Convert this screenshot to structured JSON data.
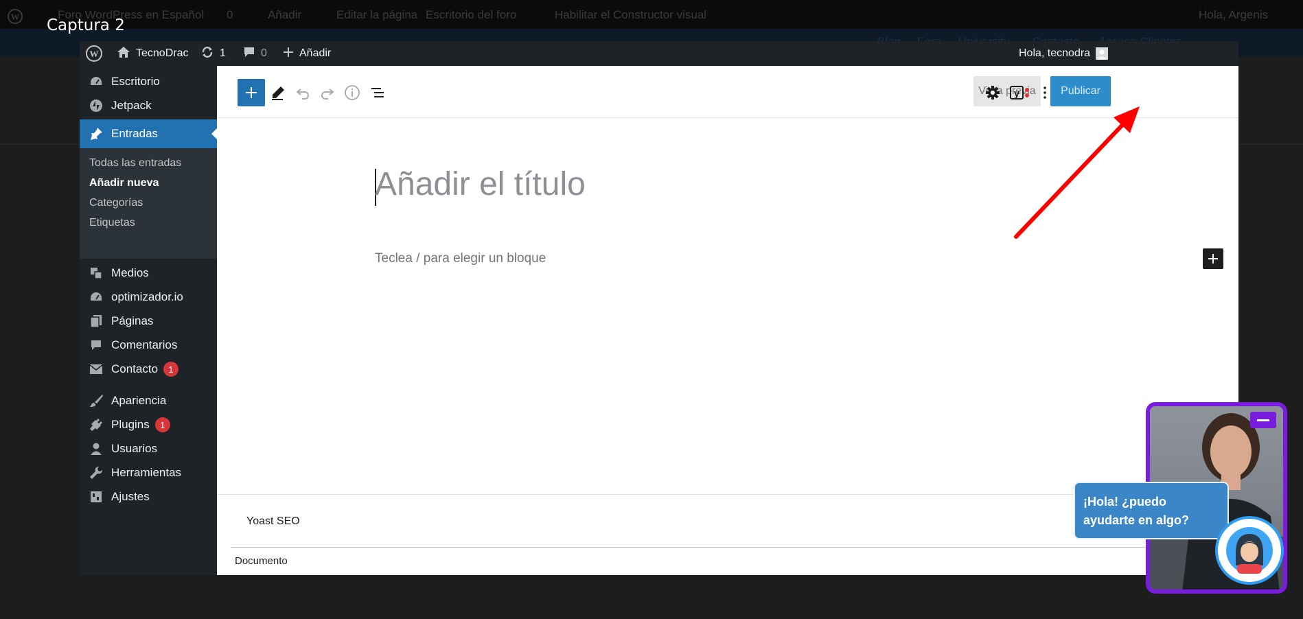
{
  "caption": "Captura 2",
  "background": {
    "adminbar_items": [
      "Foro WordPress en Español",
      "0",
      "Añadir",
      "Editar la página",
      "Escritorio del foro",
      "Habilitar el Constructor visual",
      "Hola, Argenis"
    ],
    "nav_items": [
      "Blog",
      "Foro",
      "University",
      "Contacto",
      "Acceso Clientes"
    ]
  },
  "adminbar": {
    "site_name": "TecnoDrac",
    "updates_count": "1",
    "comments_count": "0",
    "new_label": "Añadir",
    "greeting": "Hola, tecnodra"
  },
  "sidebar": {
    "items": [
      {
        "label": "Escritorio",
        "icon": "dashboard-icon"
      },
      {
        "label": "Jetpack",
        "icon": "jetpack-icon"
      },
      {
        "label": "Entradas",
        "icon": "pin-icon"
      },
      {
        "label": "Medios",
        "icon": "media-icon"
      },
      {
        "label": "optimizador.io",
        "icon": "dashboard-icon"
      },
      {
        "label": "Páginas",
        "icon": "pages-icon"
      },
      {
        "label": "Comentarios",
        "icon": "comment-icon"
      },
      {
        "label": "Contacto",
        "icon": "mail-icon",
        "badge": "1"
      },
      {
        "label": "Apariencia",
        "icon": "brush-icon"
      },
      {
        "label": "Plugins",
        "icon": "plugin-icon",
        "badge": "1"
      },
      {
        "label": "Usuarios",
        "icon": "user-icon"
      },
      {
        "label": "Herramientas",
        "icon": "wrench-icon"
      },
      {
        "label": "Ajustes",
        "icon": "settings-icon"
      }
    ],
    "submenu": [
      "Todas las entradas",
      "Añadir nueva",
      "Categorías",
      "Etiquetas"
    ]
  },
  "toolbar": {
    "preview_label": "Vista previa",
    "publish_label": "Publicar"
  },
  "editor": {
    "title_placeholder": "Añadir el título",
    "block_placeholder": "Teclea / para elegir un bloque"
  },
  "meta": {
    "yoast_label": "Yoast SEO",
    "document_label": "Documento"
  },
  "chat": {
    "bubble_line1": "¡Hola! ¿puedo",
    "bubble_line2": "ayudarte en algo?"
  },
  "colors": {
    "accent": "#2271b1",
    "adminbar": "#1d2327",
    "annotation_arrow": "#ff0000",
    "chat_border": "#7a1be0",
    "badge": "#d63638"
  }
}
